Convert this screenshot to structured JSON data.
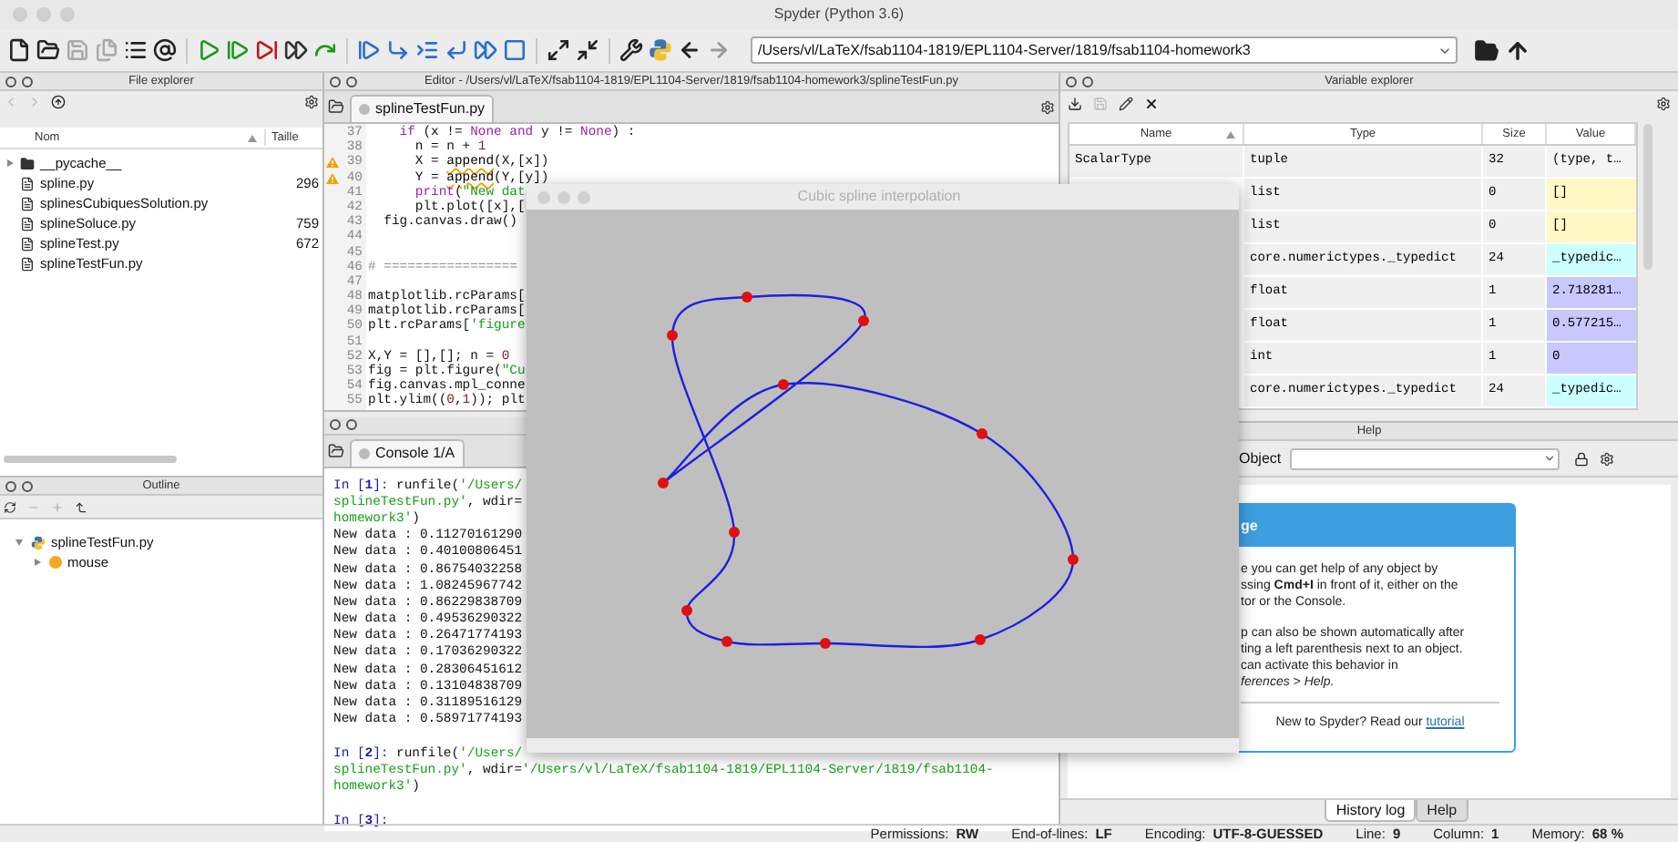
{
  "window": {
    "title": "Spyder (Python 3.6)"
  },
  "toolbar": {
    "path": "/Users/vl/LaTeX/fsab1104-1819/EPL1104-Server/1819/fsab1104-homework3"
  },
  "file_explorer": {
    "title": "File explorer",
    "columns": [
      "Nom",
      "Taille"
    ],
    "rows": [
      {
        "name": "__pycache__",
        "kind": "folder",
        "expanded": false
      },
      {
        "name": "spline.py",
        "size": "296",
        "kind": "file"
      },
      {
        "name": "splinesCubiquesSolution.py",
        "kind": "file"
      },
      {
        "name": "splineSoluce.py",
        "size": "759",
        "kind": "file"
      },
      {
        "name": "splineTest.py",
        "size": "672",
        "kind": "file"
      },
      {
        "name": "splineTestFun.py",
        "kind": "file"
      }
    ]
  },
  "outline": {
    "title": "Outline",
    "tree": [
      {
        "label": "splineTestFun.py",
        "kind": "module",
        "expanded": true,
        "children": [
          {
            "label": "mouse",
            "kind": "function",
            "expanded": false
          }
        ]
      }
    ]
  },
  "editor": {
    "title": "Editor - /Users/vl/LaTeX/fsab1104-1819/EPL1104-Server/1819/fsab1104-homework3/splineTestFun.py",
    "tabs": [
      {
        "label": "splineTestFun.py",
        "selected": true
      }
    ],
    "lines": [
      {
        "number": "37",
        "warning": false,
        "code": [
          {
            "text": "    if",
            "kind": "keyword"
          },
          {
            "text": " (x != ",
            "kind": "plain"
          },
          {
            "text": "None",
            "kind": "keyword"
          },
          {
            "text": " and",
            "kind": "keyword"
          },
          {
            "text": " y != ",
            "kind": "plain"
          },
          {
            "text": "None",
            "kind": "keyword"
          },
          {
            "text": ") :",
            "kind": "plain"
          }
        ]
      },
      {
        "number": "38",
        "warning": false,
        "code": [
          {
            "text": "      n = n + ",
            "kind": "plain"
          },
          {
            "text": "1",
            "kind": "number"
          }
        ]
      },
      {
        "number": "39",
        "warning": true,
        "code": [
          {
            "text": "      X = ",
            "kind": "plain"
          },
          {
            "text": "append",
            "kind": "flagged"
          },
          {
            "text": "(X,[x])",
            "kind": "plain"
          }
        ]
      },
      {
        "number": "40",
        "warning": true,
        "code": [
          {
            "text": "      Y = ",
            "kind": "plain"
          },
          {
            "text": "append",
            "kind": "flagged"
          },
          {
            "text": "(Y,[y])",
            "kind": "plain"
          }
        ]
      },
      {
        "number": "41",
        "warning": false,
        "code": [
          {
            "text": "      print",
            "kind": "builtin"
          },
          {
            "text": "(",
            "kind": "plain"
          },
          {
            "text": "\"New dat",
            "kind": "string"
          }
        ]
      },
      {
        "number": "42",
        "warning": false,
        "code": [
          {
            "text": "      plt.plot([x],[",
            "kind": "plain"
          }
        ]
      },
      {
        "number": "43",
        "warning": false,
        "code": [
          {
            "text": "  fig.canvas.draw()",
            "kind": "plain"
          }
        ]
      },
      {
        "number": "44",
        "warning": false
      },
      {
        "number": "45",
        "warning": false
      },
      {
        "number": "46",
        "warning": false,
        "code": [
          {
            "text": "# =================",
            "kind": "comment"
          }
        ]
      },
      {
        "number": "47",
        "warning": false
      },
      {
        "number": "48",
        "warning": false,
        "code": [
          {
            "text": "matplotlib.rcParams[",
            "kind": "plain"
          }
        ]
      },
      {
        "number": "49",
        "warning": false,
        "code": [
          {
            "text": "matplotlib.rcParams[",
            "kind": "plain"
          }
        ]
      },
      {
        "number": "50",
        "warning": false,
        "code": [
          {
            "text": "plt.rcParams[",
            "kind": "plain"
          },
          {
            "text": "'figure",
            "kind": "string"
          }
        ]
      },
      {
        "number": "51",
        "warning": false
      },
      {
        "number": "52",
        "warning": false,
        "code": [
          {
            "text": "X,Y = [],[]; n = ",
            "kind": "plain"
          },
          {
            "text": "0",
            "kind": "number"
          }
        ]
      },
      {
        "number": "53",
        "warning": false,
        "code": [
          {
            "text": "fig = plt.figure(",
            "kind": "plain"
          },
          {
            "text": "\"Cu",
            "kind": "string"
          }
        ]
      },
      {
        "number": "54",
        "warning": false,
        "code": [
          {
            "text": "fig.canvas.mpl_conne",
            "kind": "plain"
          }
        ]
      },
      {
        "number": "55",
        "warning": false,
        "code": [
          {
            "text": "plt.ylim((",
            "kind": "plain"
          },
          {
            "text": "0",
            "kind": "number"
          },
          {
            "text": ",",
            "kind": "plain"
          },
          {
            "text": "1",
            "kind": "number"
          },
          {
            "text": ")); plt",
            "kind": "plain"
          }
        ]
      }
    ]
  },
  "console": {
    "tabs": [
      {
        "label": "Console 1/A",
        "selected": true
      }
    ],
    "blocks": [
      [
        [
          {
            "text": "In [",
            "kind": "prompt"
          },
          {
            "text": "1",
            "kind": "prompt_number"
          },
          {
            "text": "]: ",
            "kind": "prompt"
          },
          {
            "text": "runfile(",
            "kind": "plain"
          },
          {
            "text": "'/Users/",
            "kind": "string"
          }
        ],
        [
          {
            "text": "splineTestFun.py'",
            "kind": "string"
          },
          {
            "text": ", wdir=",
            "kind": "plain"
          }
        ],
        [
          {
            "text": "homework3'",
            "kind": "string"
          },
          {
            "text": ")",
            "kind": "plain"
          }
        ],
        [
          {
            "text": "New data : 0.11270161290",
            "kind": "plain"
          }
        ],
        [
          {
            "text": "New data : 0.40100806451",
            "kind": "plain"
          }
        ],
        [
          {
            "text": "New data : 0.86754032258",
            "kind": "plain"
          }
        ],
        [
          {
            "text": "New data : 1.08245967742",
            "kind": "plain"
          }
        ],
        [
          {
            "text": "New data : 0.86229838709",
            "kind": "plain"
          }
        ],
        [
          {
            "text": "New data : 0.49536290322",
            "kind": "plain"
          }
        ],
        [
          {
            "text": "New data : 0.26471774193",
            "kind": "plain"
          }
        ],
        [
          {
            "text": "New data : 0.17036290322",
            "kind": "plain"
          }
        ],
        [
          {
            "text": "New data : 0.28306451612",
            "kind": "plain"
          }
        ],
        [
          {
            "text": "New data : 0.13104838709",
            "kind": "plain"
          }
        ],
        [
          {
            "text": "New data : 0.31189516129",
            "kind": "plain"
          }
        ],
        [
          {
            "text": "New data : 0.58971774193",
            "kind": "plain"
          }
        ]
      ],
      [
        [
          {
            "text": "In [",
            "kind": "prompt"
          },
          {
            "text": "2",
            "kind": "prompt_number"
          },
          {
            "text": "]: ",
            "kind": "prompt"
          },
          {
            "text": "runfile(",
            "kind": "plain"
          },
          {
            "text": "'/Users/",
            "kind": "string"
          }
        ],
        [
          {
            "text": "splineTestFun.py'",
            "kind": "string"
          },
          {
            "text": ", wdir=",
            "kind": "plain"
          },
          {
            "text": "'/Users/vl/LaTeX/fsab1104-1819/EPL1104-Server/1819/fsab1104-",
            "kind": "string"
          }
        ],
        [
          {
            "text": "homework3'",
            "kind": "string"
          },
          {
            "text": ")",
            "kind": "plain"
          }
        ]
      ],
      [
        [
          {
            "text": "In [",
            "kind": "prompt"
          },
          {
            "text": "3",
            "kind": "prompt_number"
          },
          {
            "text": "]: ",
            "kind": "prompt"
          }
        ]
      ]
    ]
  },
  "variable_explorer": {
    "title": "Variable explorer",
    "columns": [
      "Name",
      "Type",
      "Size",
      "Value"
    ],
    "rows": [
      {
        "name": "ScalarType",
        "type": "tuple",
        "size": "32",
        "value": "(type, t…",
        "color": "#f4f4f4"
      },
      {
        "type": "list",
        "size": "0",
        "value": "[]",
        "color": "#fff8c4"
      },
      {
        "type": "list",
        "size": "0",
        "value": "[]",
        "color": "#fff8c4"
      },
      {
        "type": "core.numerictypes._typedict",
        "size": "24",
        "value": "_typedic…",
        "color": "#ccffff"
      },
      {
        "type": "float",
        "size": "1",
        "value": "2.718281…",
        "color": "#c8c8ff"
      },
      {
        "type": "float",
        "size": "1",
        "value": "0.577215…",
        "color": "#c8c8ff"
      },
      {
        "type": "int",
        "size": "1",
        "value": "0",
        "color": "#c8c8ff"
      },
      {
        "type": "core.numerictypes._typedict",
        "size": "24",
        "value": "_typedic…",
        "color": "#ccffff"
      }
    ]
  },
  "help": {
    "title": "Help",
    "object_label": "Object",
    "heading": "ge",
    "paragraphs": [
      [
        "e you can get help of any object by",
        "ssing **Cmd+I** in front of it, either on the",
        "tor or the Console."
      ],
      [
        "p can also be shown automatically after",
        "ting a left parenthesis next to an object.",
        "can activate this behavior in",
        "*ferences > Help.*"
      ]
    ],
    "footer": "New to Spyder? Read our ",
    "footer_link": "tutorial",
    "tabs": [
      {
        "label": "History log",
        "selected": true
      },
      {
        "label": "Help",
        "selected": false
      }
    ]
  },
  "figure_window": {
    "title": "Cubic spline interpolation"
  },
  "status_bar": [
    {
      "label": "Permissions:",
      "value": "RW"
    },
    {
      "label": "End-of-lines:",
      "value": "LF"
    },
    {
      "label": "Encoding:",
      "value": "UTF-8-GUESSED"
    },
    {
      "label": "Line:",
      "value": "9"
    },
    {
      "label": "Column:",
      "value": "1"
    },
    {
      "label": "Memory:",
      "value": "68 %"
    }
  ]
}
